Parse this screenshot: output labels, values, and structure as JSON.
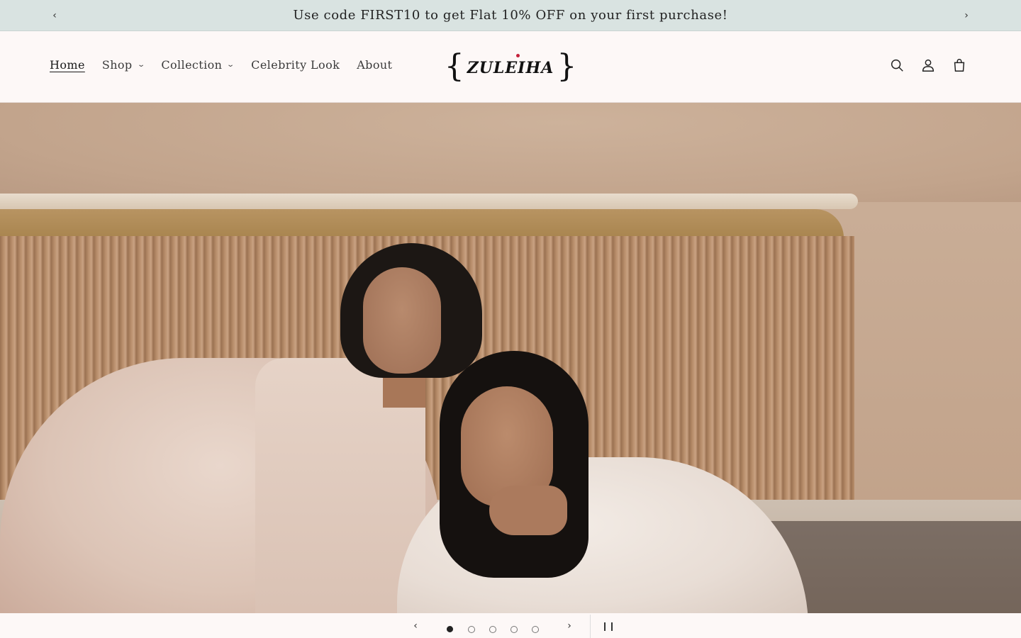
{
  "announcement": {
    "text": "Use code FIRST10 to get Flat 10% OFF on your first purchase!",
    "prev_icon": "chevron-left-icon",
    "next_icon": "chevron-right-icon"
  },
  "header": {
    "nav": [
      {
        "label": "Home",
        "active": true
      },
      {
        "label": "Shop",
        "dropdown": true
      },
      {
        "label": "Collection",
        "dropdown": true
      },
      {
        "label": "Celebrity Look"
      },
      {
        "label": "About"
      }
    ],
    "logo": {
      "text": "ZULEIHA"
    },
    "icons": [
      "search-icon",
      "account-icon",
      "cart-icon"
    ]
  },
  "hero": {
    "slide_count": 5,
    "active_slide": 1
  },
  "colors": {
    "announcement_bg": "#d9e3e1",
    "page_bg": "#fdf8f7",
    "logo_accent": "#c4203a"
  }
}
